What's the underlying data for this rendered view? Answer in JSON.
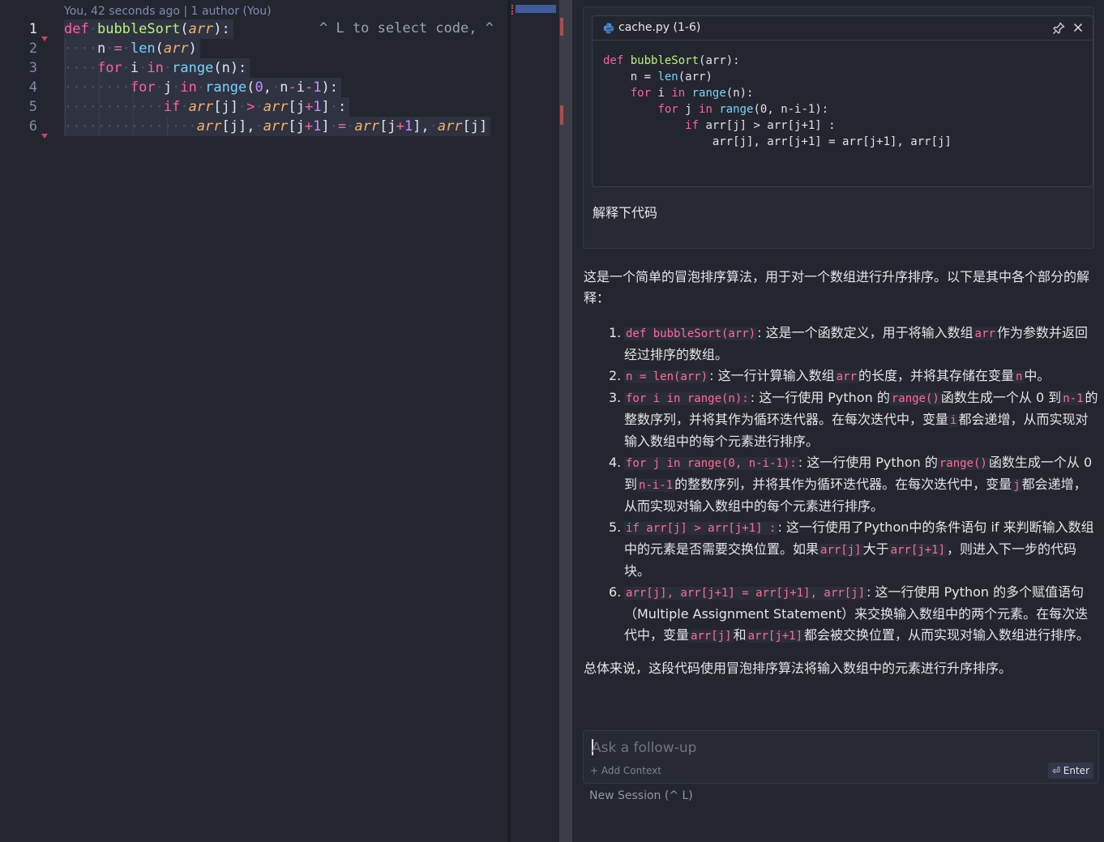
{
  "editor": {
    "blame": "You, 42 seconds ago | 1 author (You)",
    "hint": "^ L to select code, ^",
    "line_numbers": [
      "1",
      "2",
      "3",
      "4",
      "5",
      "6"
    ]
  },
  "chat": {
    "context_file": "cache.py (1-6)",
    "context_code": [
      "def bubbleSort(arr):",
      "    n = len(arr)",
      "    for i in range(n):",
      "        for j in range(0, n-i-1):",
      "            if arr[j] > arr[j+1] :",
      "                arr[j], arr[j+1] = arr[j+1], arr[j]"
    ],
    "user_prompt": "解释下代码",
    "answer_intro": "这是一个简单的冒泡排序算法，用于对一个数组进行升序排序。以下是其中各个部分的解释：",
    "items": [
      {
        "num": "1.",
        "code": "def bubbleSort(arr)",
        "t1": ": 这是一个函数定义，用于将输入数组",
        "c2": "arr",
        "t2": "作为参数并返回经过排序的数组。"
      },
      {
        "num": "2.",
        "code": "n = len(arr)",
        "t1": ": 这一行计算输入数组",
        "c2": "arr",
        "t2": "的长度，并将其存储在变量",
        "c3": "n",
        "t3": "中。"
      },
      {
        "num": "3.",
        "code": "for i in range(n):",
        "t1": ": 这一行使用 Python 的",
        "c2": "range()",
        "t2": "函数生成一个从 0 到",
        "c3": "n-1",
        "t3": "的整数序列，并将其作为循环迭代器。在每次迭代中，变量",
        "c4": "i",
        "t4": "都会递增，从而实现对输入数组中的每个元素进行排序。"
      },
      {
        "num": "4.",
        "code": "for j in range(0, n-i-1):",
        "t1": ": 这一行使用 Python 的",
        "c2": "range()",
        "t2": "函数生成一个从 0 到",
        "c3": "n-i-1",
        "t3": "的整数序列，并将其作为循环迭代器。在每次迭代中，变量",
        "c4": "j",
        "t4": "都会递增，从而实现对输入数组中的每个元素进行排序。"
      },
      {
        "num": "5.",
        "code": "if arr[j] > arr[j+1] :",
        "t1": ": 这一行使用了Python中的条件语句 if 来判断输入数组中的元素是否需要交换位置。如果",
        "c2": "arr[j]",
        "t2": "大于",
        "c3": "arr[j+1]",
        "t3": "，则进入下一步的代码块。"
      },
      {
        "num": "6.",
        "code": "arr[j], arr[j+1] = arr[j+1], arr[j]",
        "t1": ": 这一行使用 Python 的多个赋值语句（Multiple Assignment Statement）来交换输入数组中的两个元素。在每次迭代中，变量",
        "c2": "arr[j]",
        "t2": "和",
        "c3": "arr[j+1]",
        "t3": "都会被交换位置，从而实现对输入数组进行排序。"
      }
    ],
    "summary": "总体来说，这段代码使用冒泡排序算法将输入数组中的元素进行升序排序。",
    "followup_placeholder": "Ask a follow-up",
    "add_context": "+ Add Context",
    "enter_label": "⏎ Enter",
    "new_session": "New Session (^ L)"
  },
  "icons": {
    "file": "python-icon",
    "pin": "pin-icon",
    "close": "close-icon"
  },
  "colors": {
    "keyword": "#ff5fa2",
    "function": "#b7f27a",
    "builtin": "#75d4ff",
    "param": "#f2b26b",
    "number": "#c690ff",
    "inline_code": "#ff6b9a"
  }
}
